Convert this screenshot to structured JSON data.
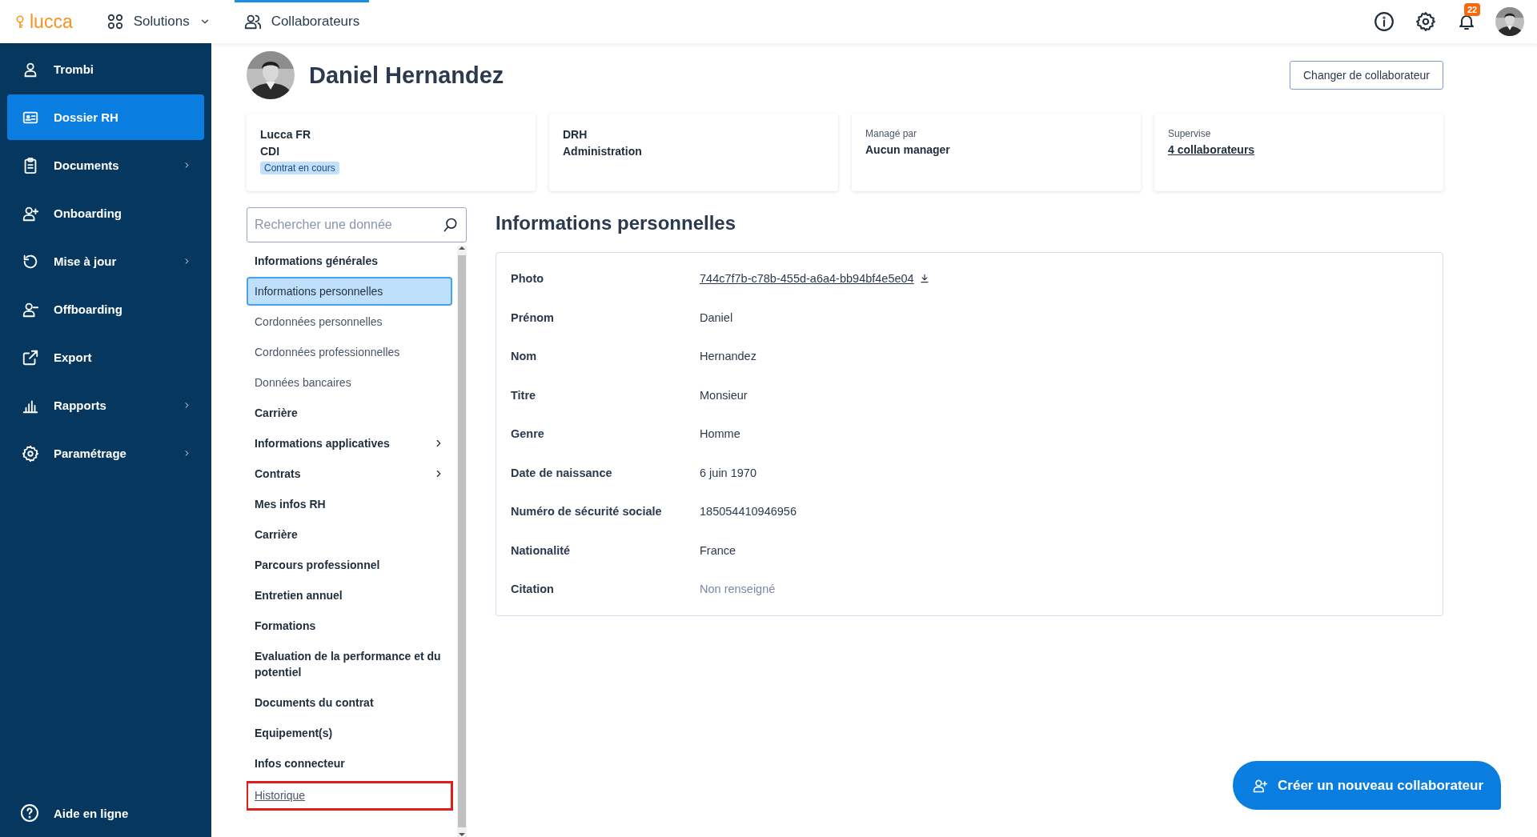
{
  "topbar": {
    "logo": "lucca",
    "menus": [
      {
        "label": "Solutions",
        "dropdown": true,
        "selected": false
      },
      {
        "label": "Collaborateurs",
        "dropdown": false,
        "selected": true
      }
    ],
    "notifications": "22"
  },
  "sidebar": {
    "items": [
      {
        "label": "Trombi",
        "submenu": false,
        "selected": false
      },
      {
        "label": "Dossier RH",
        "submenu": false,
        "selected": true
      },
      {
        "label": "Documents",
        "submenu": true,
        "selected": false
      },
      {
        "label": "Onboarding",
        "submenu": false,
        "selected": false
      },
      {
        "label": "Mise à jour",
        "submenu": true,
        "selected": false
      },
      {
        "label": "Offboarding",
        "submenu": false,
        "selected": false
      },
      {
        "label": "Export",
        "submenu": false,
        "selected": false
      },
      {
        "label": "Rapports",
        "submenu": true,
        "selected": false
      },
      {
        "label": "Paramétrage",
        "submenu": true,
        "selected": false
      }
    ],
    "help": "Aide en ligne"
  },
  "employee": {
    "name": "Daniel Hernandez",
    "change_button": "Changer de collaborateur"
  },
  "cards": [
    {
      "lines": [
        {
          "kind": "value",
          "text": "Lucca FR"
        },
        {
          "kind": "value",
          "text": "CDI"
        },
        {
          "kind": "badge",
          "text": "Contrat en cours"
        }
      ]
    },
    {
      "lines": [
        {
          "kind": "value",
          "text": "DRH"
        },
        {
          "kind": "value",
          "text": "Administration"
        }
      ]
    },
    {
      "lines": [
        {
          "kind": "caption",
          "text": "Managé par"
        },
        {
          "kind": "value",
          "text": "Aucun manager"
        }
      ]
    },
    {
      "lines": [
        {
          "kind": "caption",
          "text": "Supervise"
        },
        {
          "kind": "link",
          "text": "4 collaborateurs"
        }
      ]
    }
  ],
  "search": {
    "placeholder": "Rechercher une donnée"
  },
  "nav": [
    {
      "kind": "section",
      "label": "Informations générales",
      "selected": false,
      "expandable": false,
      "highlighted": false
    },
    {
      "kind": "page",
      "label": "Informations personnelles",
      "selected": true,
      "expandable": false,
      "highlighted": false
    },
    {
      "kind": "page",
      "label": "Cordonnées personnelles",
      "selected": false,
      "expandable": false,
      "highlighted": false
    },
    {
      "kind": "page",
      "label": "Cordonnées professionnelles",
      "selected": false,
      "expandable": false,
      "highlighted": false
    },
    {
      "kind": "page",
      "label": "Données bancaires",
      "selected": false,
      "expandable": false,
      "highlighted": false
    },
    {
      "kind": "section",
      "label": "Carrière",
      "selected": false,
      "expandable": false,
      "highlighted": false
    },
    {
      "kind": "section",
      "label": "Informations applicatives",
      "selected": false,
      "expandable": true,
      "highlighted": false
    },
    {
      "kind": "section",
      "label": "Contrats",
      "selected": false,
      "expandable": true,
      "highlighted": false
    },
    {
      "kind": "section",
      "label": "Mes infos RH",
      "selected": false,
      "expandable": false,
      "highlighted": false
    },
    {
      "kind": "section",
      "label": "Carrière",
      "selected": false,
      "expandable": false,
      "highlighted": false
    },
    {
      "kind": "section",
      "label": "Parcours professionnel",
      "selected": false,
      "expandable": false,
      "highlighted": false
    },
    {
      "kind": "section",
      "label": "Entretien annuel",
      "selected": false,
      "expandable": false,
      "highlighted": false
    },
    {
      "kind": "section",
      "label": "Formations",
      "selected": false,
      "expandable": false,
      "highlighted": false
    },
    {
      "kind": "section",
      "label": "Evaluation de la performance et du potentiel",
      "selected": false,
      "expandable": false,
      "highlighted": false
    },
    {
      "kind": "section",
      "label": "Documents du contrat",
      "selected": false,
      "expandable": false,
      "highlighted": false
    },
    {
      "kind": "section",
      "label": "Equipement(s)",
      "selected": false,
      "expandable": false,
      "highlighted": false
    },
    {
      "kind": "section",
      "label": "Infos connecteur",
      "selected": false,
      "expandable": false,
      "highlighted": false
    },
    {
      "kind": "link",
      "label": "Historique",
      "selected": false,
      "expandable": false,
      "highlighted": true
    }
  ],
  "section": {
    "title": "Informations personnelles",
    "fields": [
      {
        "label": "Photo",
        "value": "744c7f7b-c78b-455d-a6a4-bb94bf4e5e04",
        "kind": "file"
      },
      {
        "label": "Prénom",
        "value": "Daniel",
        "kind": "text"
      },
      {
        "label": "Nom",
        "value": "Hernandez",
        "kind": "text"
      },
      {
        "label": "Titre",
        "value": "Monsieur",
        "kind": "text"
      },
      {
        "label": "Genre",
        "value": "Homme",
        "kind": "text"
      },
      {
        "label": "Date de naissance",
        "value": "6 juin 1970",
        "kind": "text"
      },
      {
        "label": "Numéro de sécurité sociale",
        "value": "185054410946956",
        "kind": "text"
      },
      {
        "label": "Nationalité",
        "value": "France",
        "kind": "text"
      },
      {
        "label": "Citation",
        "value": "Non renseigné",
        "kind": "empty"
      }
    ]
  },
  "create_button": "Créer un nouveau collaborateur"
}
